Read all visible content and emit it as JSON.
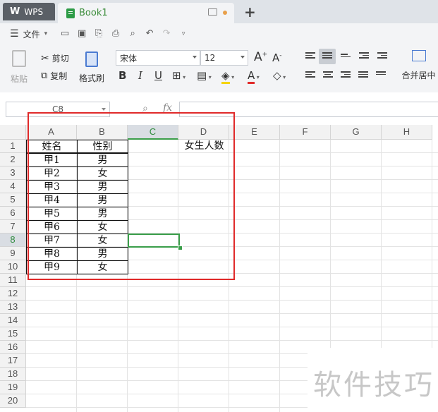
{
  "titlebar": {
    "app_tab": "WPS",
    "doc_tab": "Book1",
    "new_tab": "+"
  },
  "menu": {
    "file": "文件"
  },
  "ribbon": {
    "paste": "粘贴",
    "cut": "剪切",
    "copy": "复制",
    "format_painter": "格式刷",
    "font_name": "宋体",
    "font_size": "12",
    "merge_center": "合并居中",
    "bold": "B",
    "italic": "I",
    "underline": "U",
    "font_color_letter": "A",
    "grow_font": "A",
    "shrink_font": "A"
  },
  "formula_bar": {
    "name_box": "C8",
    "fx": "fx",
    "value": ""
  },
  "columns": [
    "A",
    "B",
    "C",
    "D",
    "E",
    "F",
    "G",
    "H"
  ],
  "rows": [
    "1",
    "2",
    "3",
    "4",
    "5",
    "6",
    "7",
    "8",
    "9",
    "10",
    "11",
    "12",
    "13",
    "14",
    "15",
    "16",
    "17",
    "18",
    "19",
    "20"
  ],
  "active_cell": {
    "column": "C",
    "row": "8"
  },
  "table": {
    "header_name": "姓名",
    "header_gender": "性别",
    "d1": "女生人数",
    "records": [
      {
        "name": "甲1",
        "gender": "男"
      },
      {
        "name": "甲2",
        "gender": "女"
      },
      {
        "name": "甲3",
        "gender": "男"
      },
      {
        "name": "甲4",
        "gender": "男"
      },
      {
        "name": "甲5",
        "gender": "男"
      },
      {
        "name": "甲6",
        "gender": "女"
      },
      {
        "name": "甲7",
        "gender": "女"
      },
      {
        "name": "甲8",
        "gender": "男"
      },
      {
        "name": "甲9",
        "gender": "女"
      }
    ]
  },
  "watermark": "软件技巧",
  "colors": {
    "accent_green": "#3a9e4a",
    "highlight_red": "#e02a2a",
    "wps_tab": "#5a5f66"
  }
}
